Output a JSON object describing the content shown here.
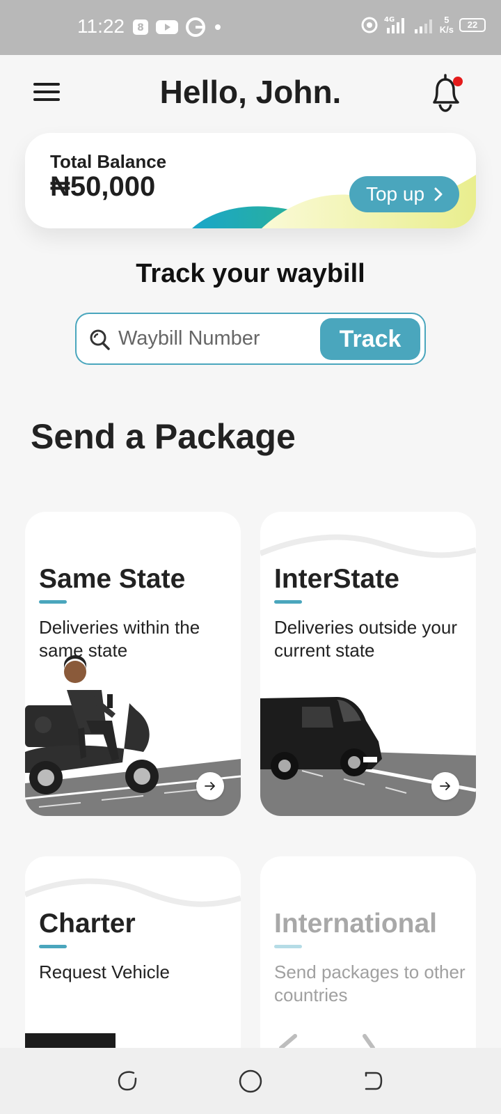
{
  "status_bar": {
    "time": "11:22",
    "network": "4G",
    "speed_value": "5",
    "speed_unit": "K/s",
    "battery": "22"
  },
  "header": {
    "greeting": "Hello, John."
  },
  "balance": {
    "label": "Total Balance",
    "amount": "₦50,000",
    "topup_label": "Top up"
  },
  "tracking": {
    "title": "Track your waybill",
    "placeholder": "Waybill Number",
    "button_label": "Track"
  },
  "send_section": {
    "title": "Send a Package",
    "cards": [
      {
        "title": "Same State",
        "description": "Deliveries within the same state",
        "icon": "scooter-rider"
      },
      {
        "title": "InterState",
        "description": "Deliveries outside your current state",
        "icon": "van"
      },
      {
        "title": "Charter",
        "description": "Request Vehicle",
        "icon": "truck"
      },
      {
        "title": "International",
        "description": "Send packages to other countries",
        "icon": "airplane"
      }
    ]
  },
  "colors": {
    "accent": "#4aa6bd",
    "notification_dot": "#e41b1b",
    "status_bar": "#b8b8b8"
  }
}
